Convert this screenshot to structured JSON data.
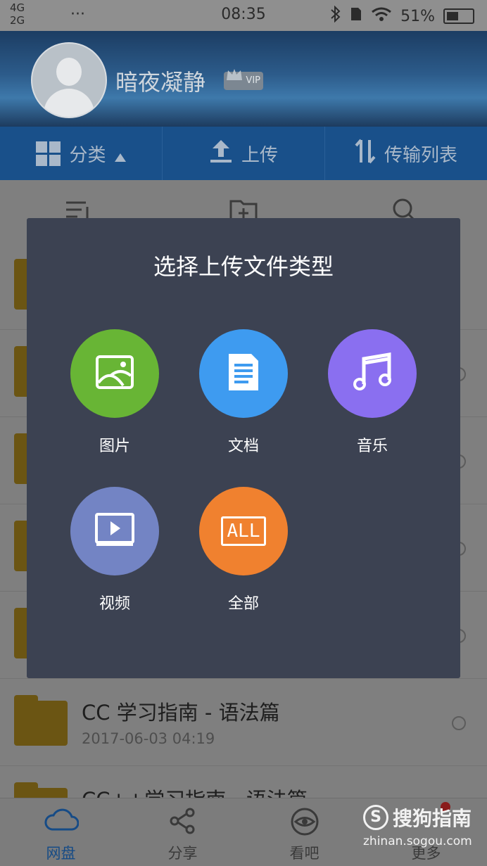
{
  "status_bar": {
    "network_top": "4G",
    "network_bottom": "2G",
    "dots": "···",
    "time": "08:35",
    "battery": "51%"
  },
  "profile": {
    "username": "暗夜凝静",
    "badge": "VIP"
  },
  "actions": [
    {
      "label": "分类",
      "icon": "grid-icon"
    },
    {
      "label": "上传",
      "icon": "upload-icon"
    },
    {
      "label": "传输列表",
      "icon": "transfer-icon"
    }
  ],
  "files": [
    {
      "name": "CC  学习指南 - 语法篇",
      "date": "2017-06-03  04:19"
    },
    {
      "name": "CC++学习指南 - 语法篇",
      "date": ""
    }
  ],
  "dialog": {
    "title": "选择上传文件类型",
    "options": [
      {
        "label": "图片",
        "icon": "image-icon",
        "color": "#68b535"
      },
      {
        "label": "文档",
        "icon": "document-icon",
        "color": "#3e9bf0"
      },
      {
        "label": "音乐",
        "icon": "music-icon",
        "color": "#8a6ff0"
      },
      {
        "label": "视频",
        "icon": "video-icon",
        "color": "#7384c4"
      },
      {
        "label": "全部",
        "icon": "all-icon",
        "color": "#f0812f"
      }
    ],
    "all_text": "ALL"
  },
  "bottom_nav": [
    {
      "label": "网盘",
      "icon": "cloud-icon",
      "active": true
    },
    {
      "label": "分享",
      "icon": "share-icon",
      "active": false
    },
    {
      "label": "看吧",
      "icon": "eye-icon",
      "active": false
    },
    {
      "label": "更多",
      "icon": "more-icon",
      "active": false
    }
  ],
  "watermark": {
    "logo_letter": "S",
    "name": "搜狗指南",
    "url": "zhinan.sogou.com"
  }
}
